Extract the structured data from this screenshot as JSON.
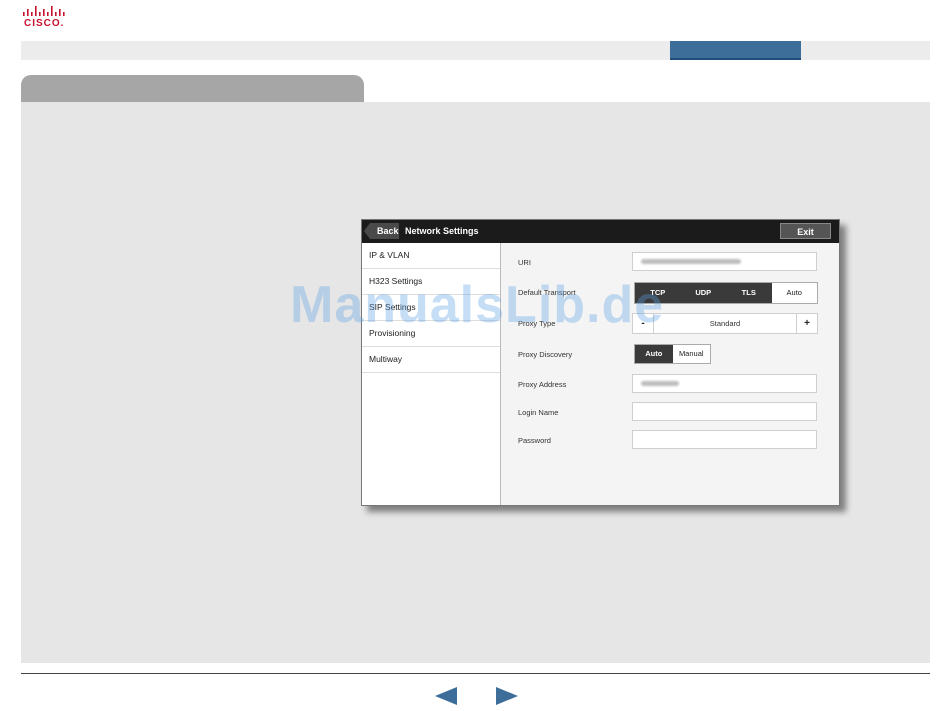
{
  "brand": {
    "logo_text": "CISCO.",
    "color": "#c8102e"
  },
  "topbar": {
    "active_tab_color": "#3d6d99"
  },
  "device": {
    "header": {
      "back_label": "Back",
      "title": "Network Settings",
      "exit_label": "Exit"
    },
    "menu": [
      {
        "label": "IP & VLAN"
      },
      {
        "label": "H323 Settings"
      },
      {
        "label": "SIP Settings"
      },
      {
        "label": "Provisioning"
      },
      {
        "label": "Multiway"
      }
    ],
    "form": {
      "uri_label": "URI",
      "transport_label": "Default Transport",
      "transport_options": [
        "TCP",
        "UDP",
        "TLS",
        "Auto"
      ],
      "transport_selected": "Auto",
      "proxy_type_label": "Proxy Type",
      "proxy_type_minus": "-",
      "proxy_type_value": "Standard",
      "proxy_type_plus": "+",
      "proxy_discovery_label": "Proxy Discovery",
      "proxy_discovery_options": [
        "Auto",
        "Manual"
      ],
      "proxy_discovery_selected": "Auto",
      "proxy_address_label": "Proxy Address",
      "login_name_label": "Login Name",
      "password_label": "Password"
    }
  },
  "watermark": "ManualsLib.de",
  "nav": {
    "prev_icon": "triangle-left-icon",
    "next_icon": "triangle-right-icon",
    "arrow_color": "#3d6d99"
  }
}
